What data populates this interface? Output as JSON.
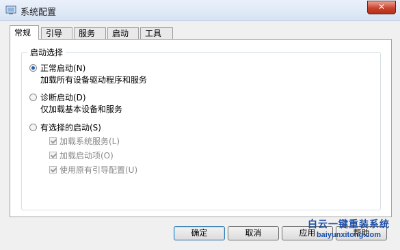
{
  "window": {
    "title": "系统配置",
    "close_label": "✕"
  },
  "tabs": [
    {
      "label": "常规",
      "active": true
    },
    {
      "label": "引导",
      "active": false
    },
    {
      "label": "服务",
      "active": false
    },
    {
      "label": "启动",
      "active": false
    },
    {
      "label": "工具",
      "active": false
    }
  ],
  "startup": {
    "group_label": "启动选择",
    "options": [
      {
        "label": "正常启动(N)",
        "description": "加载所有设备驱动程序和服务",
        "selected": true
      },
      {
        "label": "诊断启动(D)",
        "description": "仅加载基本设备和服务",
        "selected": false
      },
      {
        "label": "有选择的启动(S)",
        "selected": false
      }
    ],
    "selective": [
      {
        "label": "加载系统服务(L)",
        "checked": true,
        "enabled": false
      },
      {
        "label": "加载启动项(O)",
        "checked": true,
        "enabled": false
      },
      {
        "label": "使用原有引导配置(U)",
        "checked": true,
        "enabled": false
      }
    ]
  },
  "buttons": {
    "ok": "确定",
    "cancel": "取消",
    "apply": "应用",
    "help": "帮助"
  },
  "watermark": {
    "title": "白云一键重装系统",
    "url": "baiyunxitong.com"
  },
  "colors": {
    "accent": "#1f5fb3",
    "title_bar": "#d7e3f3",
    "close": "#c9442d"
  }
}
